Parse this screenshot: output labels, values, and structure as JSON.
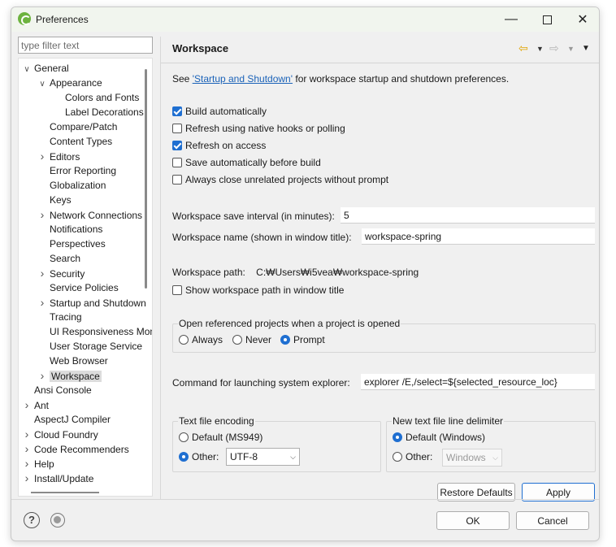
{
  "window": {
    "title": "Preferences",
    "minimize_glyph": "—",
    "close_glyph": "✕"
  },
  "filter": {
    "placeholder": "type filter text",
    "value": ""
  },
  "tree": [
    {
      "label": "General",
      "level": 0,
      "arrow": "expanded"
    },
    {
      "label": "Appearance",
      "level": 1,
      "arrow": "expanded"
    },
    {
      "label": "Colors and Fonts",
      "level": 2,
      "arrow": "none"
    },
    {
      "label": "Label Decorations",
      "level": 2,
      "arrow": "none"
    },
    {
      "label": "Compare/Patch",
      "level": 1,
      "arrow": "none"
    },
    {
      "label": "Content Types",
      "level": 1,
      "arrow": "none"
    },
    {
      "label": "Editors",
      "level": 1,
      "arrow": "collapsed"
    },
    {
      "label": "Error Reporting",
      "level": 1,
      "arrow": "none"
    },
    {
      "label": "Globalization",
      "level": 1,
      "arrow": "none"
    },
    {
      "label": "Keys",
      "level": 1,
      "arrow": "none"
    },
    {
      "label": "Network Connections",
      "level": 1,
      "arrow": "collapsed"
    },
    {
      "label": "Notifications",
      "level": 1,
      "arrow": "none"
    },
    {
      "label": "Perspectives",
      "level": 1,
      "arrow": "none"
    },
    {
      "label": "Search",
      "level": 1,
      "arrow": "none"
    },
    {
      "label": "Security",
      "level": 1,
      "arrow": "collapsed"
    },
    {
      "label": "Service Policies",
      "level": 1,
      "arrow": "none"
    },
    {
      "label": "Startup and Shutdown",
      "level": 1,
      "arrow": "collapsed"
    },
    {
      "label": "Tracing",
      "level": 1,
      "arrow": "none"
    },
    {
      "label": "UI Responsiveness Monitoring",
      "level": 1,
      "arrow": "none"
    },
    {
      "label": "User Storage Service",
      "level": 1,
      "arrow": "none"
    },
    {
      "label": "Web Browser",
      "level": 1,
      "arrow": "none"
    },
    {
      "label": "Workspace",
      "level": 1,
      "arrow": "collapsed",
      "selected": true
    },
    {
      "label": "Ansi Console",
      "level": 0,
      "arrow": "none"
    },
    {
      "label": "Ant",
      "level": 0,
      "arrow": "collapsed"
    },
    {
      "label": "AspectJ Compiler",
      "level": 0,
      "arrow": "none"
    },
    {
      "label": "Cloud Foundry",
      "level": 0,
      "arrow": "collapsed"
    },
    {
      "label": "Code Recommenders",
      "level": 0,
      "arrow": "collapsed"
    },
    {
      "label": "Help",
      "level": 0,
      "arrow": "collapsed"
    },
    {
      "label": "Install/Update",
      "level": 0,
      "arrow": "collapsed"
    }
  ],
  "page": {
    "title": "Workspace",
    "nav": {
      "back": "⇦",
      "forward": "⇨",
      "dropdown": "▼"
    },
    "see_prefix": "See ",
    "see_link": "'Startup and Shutdown'",
    "see_suffix": " for workspace startup and shutdown preferences.",
    "checkboxes": [
      {
        "label": "Build automatically",
        "checked": true
      },
      {
        "label": "Refresh using native hooks or polling",
        "checked": false
      },
      {
        "label": "Refresh on access",
        "checked": true
      },
      {
        "label": "Save automatically before build",
        "checked": false
      },
      {
        "label": "Always close unrelated projects without prompt",
        "checked": false
      }
    ],
    "save_interval_label": "Workspace save interval (in minutes):",
    "save_interval_value": "5",
    "workspace_name_label": "Workspace name (shown in window title):",
    "workspace_name_value": "workspace-spring",
    "workspace_path_label": "Workspace path:",
    "workspace_path_value": "C:₩Users₩i5vea₩workspace-spring",
    "show_path_label": "Show workspace path in window title",
    "show_path_checked": false,
    "open_ref_group_label": "Open referenced projects when a project is opened",
    "open_ref_options": [
      {
        "label": "Always",
        "checked": false
      },
      {
        "label": "Never",
        "checked": false
      },
      {
        "label": "Prompt",
        "checked": true
      }
    ],
    "explorer_label": "Command for launching system explorer:",
    "explorer_value": "explorer /E,/select=${selected_resource_loc}",
    "encoding_group_label": "Text file encoding",
    "encoding_default_label": "Default (MS949)",
    "encoding_other_label": "Other:",
    "encoding_other_value": "UTF-8",
    "encoding_selected": "other",
    "delimiter_group_label": "New text file line delimiter",
    "delimiter_default_label": "Default (Windows)",
    "delimiter_other_label": "Other:",
    "delimiter_other_value": "Windows",
    "delimiter_selected": "default",
    "restore_defaults_label": "Restore Defaults",
    "apply_label": "Apply"
  },
  "footer": {
    "help_glyph": "?",
    "ok_label": "OK",
    "cancel_label": "Cancel"
  },
  "colors": {
    "accent": "#1f6fd1",
    "link": "#1a62b8",
    "titlebar": "#f1f5ee"
  }
}
